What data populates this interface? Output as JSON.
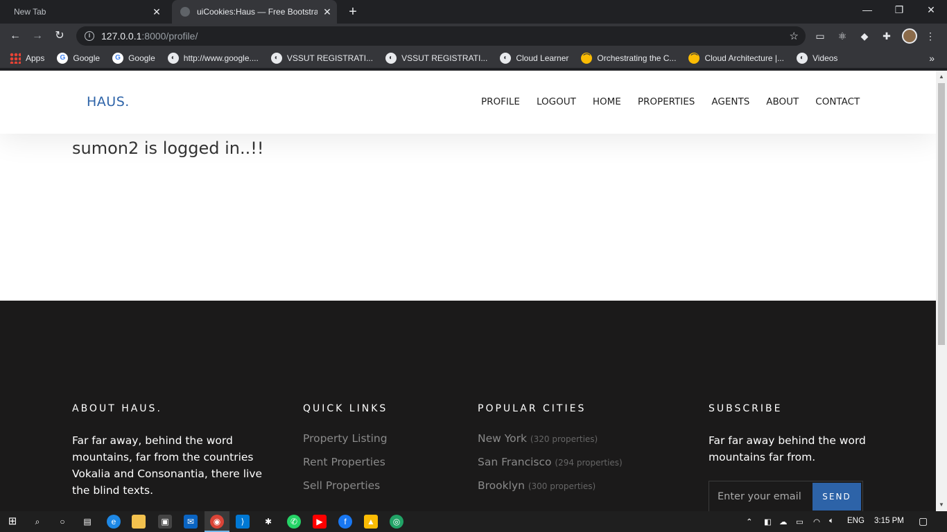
{
  "browser": {
    "tabs": [
      {
        "title": "New Tab",
        "active": false
      },
      {
        "title": "uiCookies:Haus — Free Bootstrap",
        "active": true
      }
    ],
    "new_tab_label": "+",
    "url_host": "127.0.0.1",
    "url_rest": ":8000/profile/",
    "bookmarks": [
      {
        "label": "Apps",
        "icon": "apps-icon"
      },
      {
        "label": "Google",
        "icon": "google-icon"
      },
      {
        "label": "Google",
        "icon": "google-icon"
      },
      {
        "label": "http://www.google....",
        "icon": "globe-icon"
      },
      {
        "label": "VSSUT REGISTRATI...",
        "icon": "globe-icon"
      },
      {
        "label": "VSSUT REGISTRATI...",
        "icon": "globe-icon"
      },
      {
        "label": "Cloud Learner",
        "icon": "globe-icon"
      },
      {
        "label": "Orchestrating the C...",
        "icon": "ybadge-icon"
      },
      {
        "label": "Cloud Architecture |...",
        "icon": "ybadge-icon"
      },
      {
        "label": "Videos",
        "icon": "globe-icon"
      }
    ]
  },
  "site": {
    "logo": "HAUS.",
    "nav": [
      "PROFILE",
      "LOGOUT",
      "HOME",
      "PROPERTIES",
      "AGENTS",
      "ABOUT",
      "CONTACT"
    ],
    "login_message": "sumon2 is logged in..!!",
    "accent_color": "#2d63a8"
  },
  "footer": {
    "about": {
      "heading": "ABOUT HAUS.",
      "text": "Far far away, behind the word mountains, far from the countries Vokalia and Consonantia, there live the blind texts."
    },
    "quick_links": {
      "heading": "QUICK LINKS",
      "links": [
        "Property Listing",
        "Rent Properties",
        "Sell Properties"
      ]
    },
    "popular_cities": {
      "heading": "POPULAR CITIES",
      "cities": [
        {
          "name": "New York",
          "count": "(320 properties)"
        },
        {
          "name": "San Francisco",
          "count": "(294 properties)"
        },
        {
          "name": "Brooklyn",
          "count": "(300 properties)"
        }
      ]
    },
    "subscribe": {
      "heading": "SUBSCRIBE",
      "text": "Far far away behind the word mountains far from.",
      "placeholder": "Enter your email",
      "button": "SEND"
    }
  },
  "taskbar": {
    "language": "ENG",
    "time": "3:15 PM"
  }
}
